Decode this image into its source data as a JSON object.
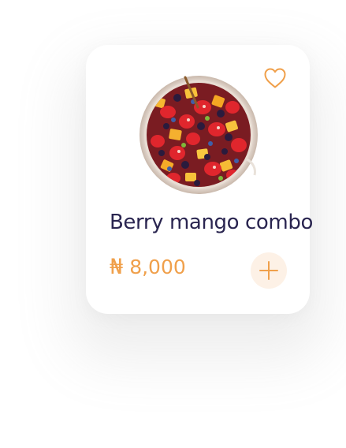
{
  "product": {
    "name": "Berry mango combo",
    "currency_symbol": "₦",
    "price": "8,000",
    "image_alt": "fruit-salad-bowl"
  },
  "icons": {
    "favorite": "heart-outline-icon",
    "add": "plus-icon"
  },
  "colors": {
    "accent": "#f0a04b",
    "title": "#2a2550",
    "add_button_bg": "#fdf1e6",
    "card_bg": "#ffffff"
  }
}
